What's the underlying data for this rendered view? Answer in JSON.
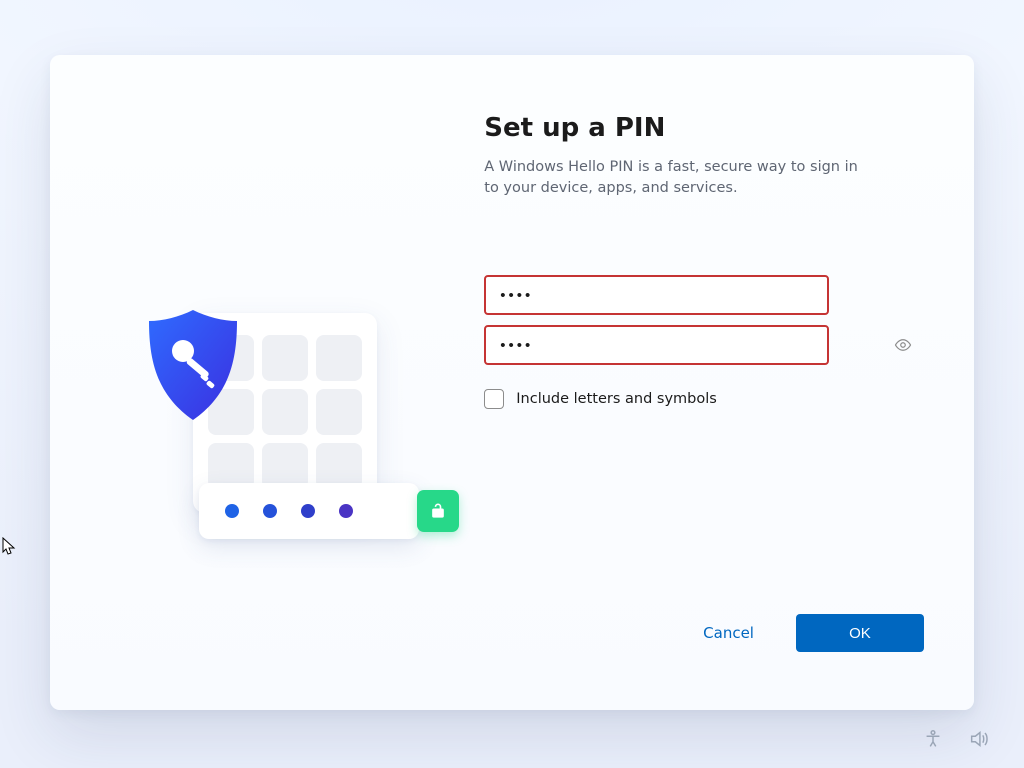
{
  "title": "Set up a PIN",
  "description": "A Windows Hello PIN is a fast, secure way to sign in to your device, apps, and services.",
  "pin_value": "••••",
  "confirm_pin_value": "••••",
  "checkbox_label": "Include letters and symbols",
  "checkbox_checked": false,
  "buttons": {
    "cancel": "Cancel",
    "ok": "OK"
  },
  "field_error_state": true,
  "colors": {
    "accent": "#0067c0",
    "error_border": "#c53434",
    "illustration_green": "#27d889"
  },
  "icons": {
    "shield": "shield-key-icon",
    "lock": "unlock-icon",
    "eye": "reveal-password-icon",
    "accessibility": "accessibility-icon",
    "volume": "volume-icon"
  }
}
